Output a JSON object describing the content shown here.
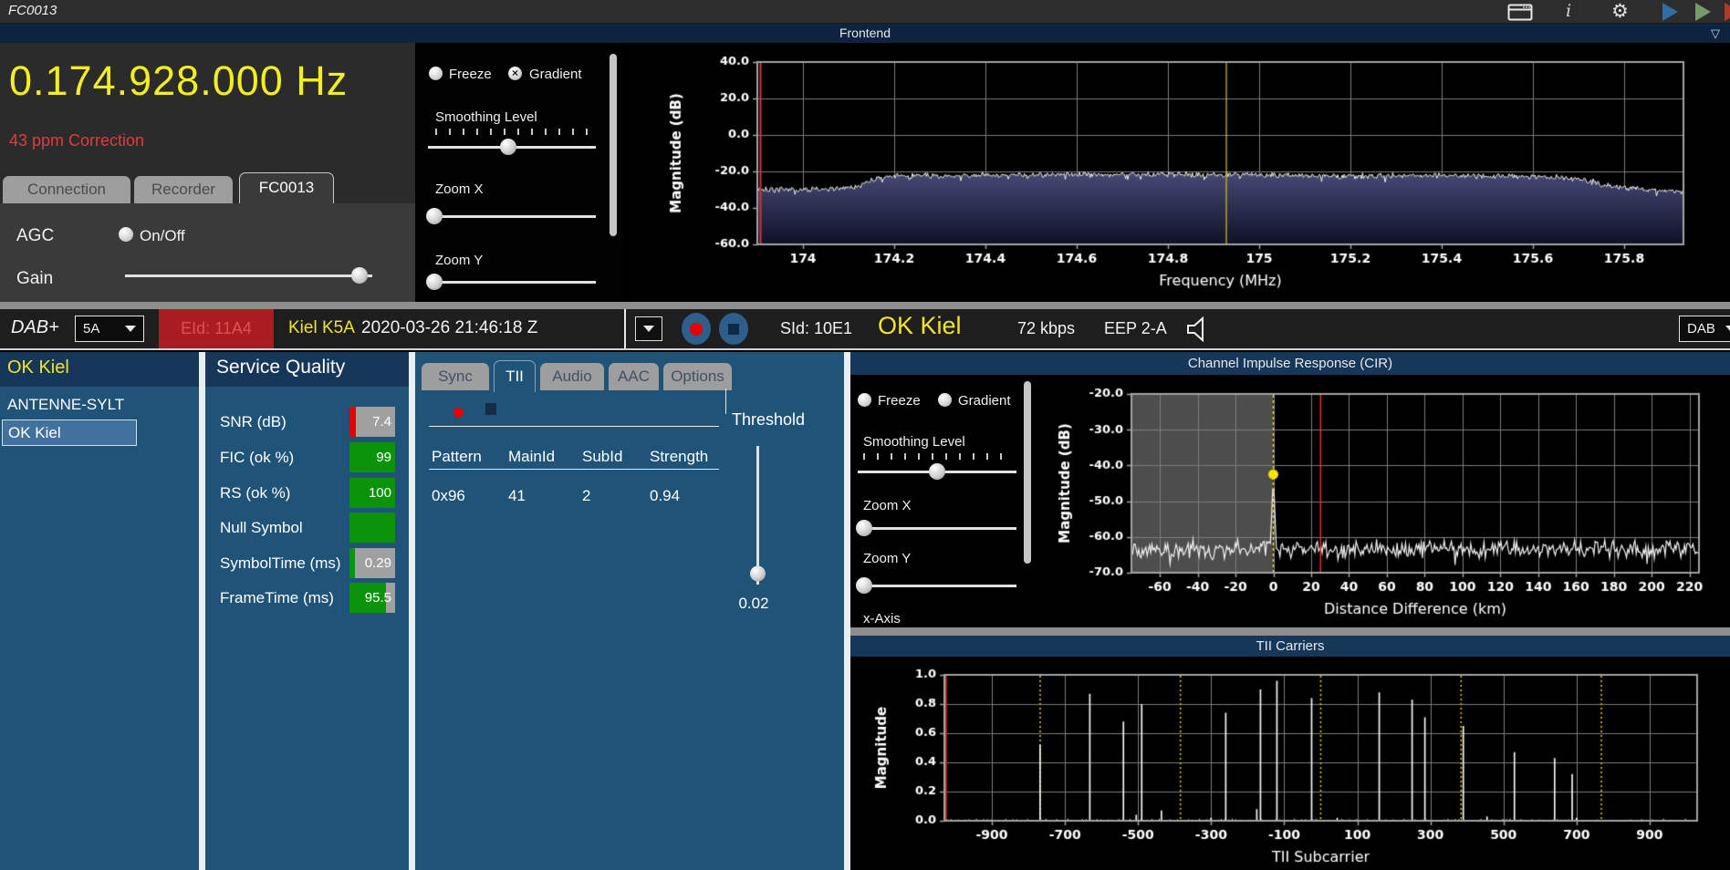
{
  "app": {
    "title": "FC0013"
  },
  "titlebar": {
    "icons": {
      "window": "window-icon",
      "info": "i",
      "gear": "⚙",
      "play_blue": "play",
      "play_green": "play",
      "red_edge": "stop"
    }
  },
  "frontend": {
    "header": "Frontend",
    "collapse_glyph": "▽",
    "frequency": "0.174.928.000 Hz",
    "correction": "43 ppm Correction",
    "tabs": [
      {
        "label": "Connection"
      },
      {
        "label": "Recorder"
      },
      {
        "label": "FC0013",
        "active": true
      }
    ],
    "agc_label": "AGC",
    "agc_option": "On/Off",
    "gain_label": "Gain",
    "gain_pos": 95,
    "controls": {
      "freeze": "Freeze",
      "gradient": "Gradient",
      "gradient_checked": true,
      "smoothing_label": "Smoothing Level",
      "smoothing_pos": 48,
      "zoomx_label": "Zoom X",
      "zoomx_pos": 4,
      "zoomy_label": "Zoom Y",
      "zoomy_pos": 4
    }
  },
  "statusbar": {
    "mode": "DAB+",
    "channel": "5A",
    "eid": "EId: 11A4",
    "ensemble": "Kiel K5A",
    "datetime": "2020-03-26  21:46:18 Z",
    "sid": "SId: 10E1",
    "service": "OK Kiel",
    "bitrate": "72 kbps",
    "protection": "EEP 2-A",
    "output_select": "DAB"
  },
  "service_list": {
    "header": "OK Kiel",
    "items": [
      "ANTENNE-SYLT",
      "OK Kiel"
    ],
    "selected": "OK Kiel"
  },
  "service_quality": {
    "header": "Service Quality",
    "rows": [
      {
        "label": "SNR (dB)",
        "value": "7.4",
        "bar": {
          "segments": [
            {
              "color": "#e60000",
              "pct": 14
            },
            {
              "color": "#a0a0a0",
              "pct": 86
            }
          ]
        }
      },
      {
        "label": "FIC (ok %)",
        "value": "99",
        "bar": {
          "segments": [
            {
              "color": "#0c930c",
              "pct": 100
            }
          ]
        }
      },
      {
        "label": "RS (ok %)",
        "value": "100",
        "bar": {
          "segments": [
            {
              "color": "#0c930c",
              "pct": 100
            }
          ]
        }
      },
      {
        "label": "Null Symbol",
        "value": "",
        "bar": {
          "segments": [
            {
              "color": "#0c930c",
              "pct": 100
            }
          ]
        }
      },
      {
        "label": "SymbolTime (ms)",
        "value": "0.29",
        "bar": {
          "segments": [
            {
              "color": "#0c930c",
              "pct": 12
            },
            {
              "color": "#a0a0a0",
              "pct": 88
            }
          ]
        }
      },
      {
        "label": "FrameTime (ms)",
        "value": "95.5",
        "bar": {
          "segments": [
            {
              "color": "#0c930c",
              "pct": 79
            },
            {
              "color": "#a0a0a0",
              "pct": 21
            }
          ]
        }
      }
    ]
  },
  "detail": {
    "tabs": [
      {
        "label": "Sync"
      },
      {
        "label": "TII",
        "active": true
      },
      {
        "label": "Audio"
      },
      {
        "label": "AAC"
      },
      {
        "label": "Options"
      }
    ],
    "tii": {
      "table": {
        "headers": [
          "Pattern",
          "MainId",
          "SubId",
          "Strength"
        ],
        "rows": [
          [
            "0x96",
            "41",
            "2",
            "0.94"
          ]
        ]
      },
      "threshold_label": "Threshold",
      "threshold_value": "0.02",
      "threshold_pos": 92
    }
  },
  "cir_panel": {
    "header": "Channel Impulse Response (CIR)",
    "controls": {
      "freeze": "Freeze",
      "gradient": "Gradient",
      "smoothing_label": "Smoothing Level",
      "smoothing_pos": 50,
      "zoomx_label": "Zoom X",
      "zoomx_pos": 4,
      "zoomy_label": "Zoom Y",
      "zoomy_pos": 4,
      "xaxis_label": "x-Axis"
    }
  },
  "tii_panel": {
    "header": "TII Carriers"
  },
  "colors": {
    "accent_yellow": "#f4e426",
    "alert_red": "#e23b3b",
    "panel_blue": "#1f5377",
    "header_navy": "#16365a",
    "ok_green": "#0c930c",
    "record_red": "#e60000"
  },
  "chart_data": [
    {
      "kind": "spectrum",
      "type": "area",
      "title": "Frontend spectrum",
      "xlabel": "Frequency (MHz)",
      "ylabel": "Magnitude (dB)",
      "xlim": [
        173.9,
        175.93
      ],
      "ylim": [
        -60,
        40
      ],
      "grid": true,
      "yticks": [
        {
          "v": 40,
          "l": "40.0"
        },
        {
          "v": 20,
          "l": "20.0"
        },
        {
          "v": 0,
          "l": "0.0"
        },
        {
          "v": -20,
          "l": "-20.0"
        },
        {
          "v": -40,
          "l": "-40.0"
        },
        {
          "v": -60,
          "l": "-60.0"
        }
      ],
      "xticks": [
        {
          "v": 174,
          "l": "174"
        },
        {
          "v": 174.2,
          "l": "174.2"
        },
        {
          "v": 174.4,
          "l": "174.4"
        },
        {
          "v": 174.6,
          "l": "174.6"
        },
        {
          "v": 174.8,
          "l": "174.8"
        },
        {
          "v": 175,
          "l": "175"
        },
        {
          "v": 175.2,
          "l": "175.2"
        },
        {
          "v": 175.4,
          "l": "175.4"
        },
        {
          "v": 175.6,
          "l": "175.6"
        },
        {
          "v": 175.8,
          "l": "175.8"
        }
      ],
      "tuned_marker_mhz": 174.928,
      "red_line_x": 173.907,
      "envelope_db": [
        [
          173.9,
          -30
        ],
        [
          173.98,
          -29.5
        ],
        [
          174.05,
          -30
        ],
        [
          174.12,
          -28
        ],
        [
          174.16,
          -24
        ],
        [
          174.2,
          -22.5
        ],
        [
          174.4,
          -22
        ],
        [
          174.6,
          -21.5
        ],
        [
          174.8,
          -21.5
        ],
        [
          175.0,
          -22
        ],
        [
          175.2,
          -22.5
        ],
        [
          175.35,
          -22
        ],
        [
          175.5,
          -22.5
        ],
        [
          175.65,
          -23
        ],
        [
          175.72,
          -25
        ],
        [
          175.78,
          -28.5
        ],
        [
          175.85,
          -30
        ],
        [
          175.93,
          -31
        ]
      ],
      "noise_amp_db": 1.8,
      "line_color": "#f2f2f2",
      "fill_top_color": "#474b76",
      "fill_bottom_color": "#0f1128",
      "marker_color": "#d8c700"
    },
    {
      "kind": "cir",
      "type": "line",
      "title": "Channel Impulse Response (CIR)",
      "xlabel": "Distance Difference (km)",
      "ylabel": "Magnitude (dB)",
      "xlim": [
        -75,
        225
      ],
      "ylim": [
        -70,
        -20
      ],
      "grid": true,
      "yticks": [
        {
          "v": -20,
          "l": "-20.0"
        },
        {
          "v": -30,
          "l": "-30.0"
        },
        {
          "v": -40,
          "l": "-40.0"
        },
        {
          "v": -50,
          "l": "-50.0"
        },
        {
          "v": -60,
          "l": "-60.0"
        },
        {
          "v": -70,
          "l": "-70.0"
        }
      ],
      "xticks": [
        {
          "v": -60,
          "l": "-60"
        },
        {
          "v": -40,
          "l": "-40"
        },
        {
          "v": -20,
          "l": "-20"
        },
        {
          "v": 0,
          "l": "0"
        },
        {
          "v": 20,
          "l": "20"
        },
        {
          "v": 40,
          "l": "40"
        },
        {
          "v": 60,
          "l": "60"
        },
        {
          "v": 80,
          "l": "80"
        },
        {
          "v": 100,
          "l": "100"
        },
        {
          "v": 120,
          "l": "120"
        },
        {
          "v": 140,
          "l": "140"
        },
        {
          "v": 160,
          "l": "160"
        },
        {
          "v": 180,
          "l": "180"
        },
        {
          "v": 200,
          "l": "200"
        },
        {
          "v": 220,
          "l": "220"
        }
      ],
      "gray_region": [
        -75,
        0
      ],
      "yellow_dashed_x": 0,
      "red_line_x": 25,
      "noise_floor_db": -63.5,
      "noise_amp_db": 3,
      "main_peak": {
        "x": 0,
        "y": -42.5
      },
      "line_color": "#f2f2f2",
      "marker_color": "#ffe000"
    },
    {
      "kind": "tii",
      "type": "impulse",
      "title": "TII Carriers",
      "xlabel": "TII Subcarrier",
      "ylabel": "Magnitude",
      "xlim": [
        -1030,
        1030
      ],
      "ylim": [
        0,
        1
      ],
      "grid": true,
      "yticks": [
        {
          "v": 1,
          "l": "1.0"
        },
        {
          "v": 0.8,
          "l": "0.8"
        },
        {
          "v": 0.6,
          "l": "0.6"
        },
        {
          "v": 0.4,
          "l": "0.4"
        },
        {
          "v": 0.2,
          "l": "0.2"
        },
        {
          "v": 0,
          "l": "0.0"
        }
      ],
      "xticks": [
        {
          "v": -900,
          "l": "-900"
        },
        {
          "v": -700,
          "l": "-700"
        },
        {
          "v": -500,
          "l": "-500"
        },
        {
          "v": -300,
          "l": "-300"
        },
        {
          "v": -100,
          "l": "-100"
        },
        {
          "v": 100,
          "l": "100"
        },
        {
          "v": 300,
          "l": "300"
        },
        {
          "v": 500,
          "l": "500"
        },
        {
          "v": 700,
          "l": "700"
        },
        {
          "v": 900,
          "l": "900"
        }
      ],
      "yellow_dotted_x": [
        -768,
        -384,
        0,
        384,
        768
      ],
      "red_line_x": -1026,
      "spikes": [
        [
          -768,
          0.52
        ],
        [
          -632,
          0.87
        ],
        [
          -540,
          0.68
        ],
        [
          -505,
          0.04
        ],
        [
          -490,
          0.8
        ],
        [
          -436,
          0.07
        ],
        [
          -300,
          0.02
        ],
        [
          -260,
          0.74
        ],
        [
          -175,
          0.08
        ],
        [
          -165,
          0.9
        ],
        [
          -120,
          0.96
        ],
        [
          -25,
          0.84
        ],
        [
          45,
          0.02
        ],
        [
          160,
          0.88
        ],
        [
          250,
          0.83
        ],
        [
          285,
          0.71
        ],
        [
          390,
          0.65
        ],
        [
          455,
          0.03
        ],
        [
          530,
          0.47
        ],
        [
          640,
          0.43
        ],
        [
          688,
          0.32
        ],
        [
          700,
          0.02
        ]
      ],
      "line_color": "#f5f5f5",
      "marker_color": "#d8c700"
    }
  ]
}
